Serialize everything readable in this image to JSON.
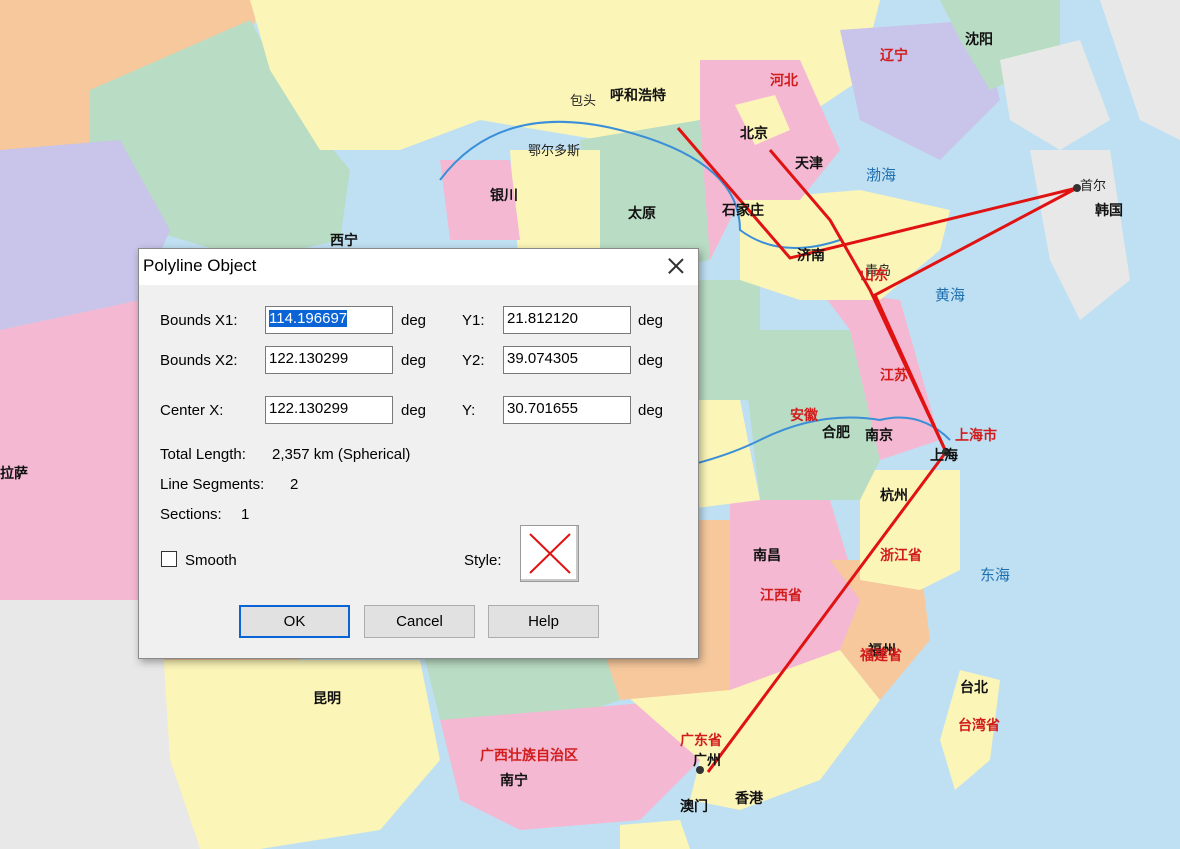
{
  "dialog": {
    "title": "Polyline Object",
    "fields": {
      "bounds_x1_label": "Bounds X1:",
      "bounds_x1_value": "114.196697",
      "bounds_x2_label": "Bounds X2:",
      "bounds_x2_value": "122.130299",
      "center_x_label": "Center X:",
      "center_x_value": "122.130299",
      "y1_label": "Y1:",
      "y1_value": "21.812120",
      "y2_label": "Y2:",
      "y2_value": "39.074305",
      "y_label": "Y:",
      "y_value": "30.701655",
      "unit": "deg"
    },
    "info": {
      "total_length_label": "Total Length:",
      "total_length_value": "2,357 km (Spherical)",
      "line_segments_label": "Line Segments:",
      "line_segments_value": "2",
      "sections_label": "Sections:",
      "sections_value": "1"
    },
    "smooth_label": "Smooth",
    "smooth_checked": false,
    "style_label": "Style:",
    "buttons": {
      "ok": "OK",
      "cancel": "Cancel",
      "help": "Help"
    }
  },
  "map": {
    "labels": [
      {
        "text": "呼和浩特",
        "cls": "big"
      },
      {
        "text": "包头",
        "cls": ""
      },
      {
        "text": "鄂尔多斯",
        "cls": ""
      },
      {
        "text": "银川",
        "cls": "big"
      },
      {
        "text": "太原",
        "cls": "big"
      },
      {
        "text": "石家庄",
        "cls": "big"
      },
      {
        "text": "北京",
        "cls": "big"
      },
      {
        "text": "天津",
        "cls": "big"
      },
      {
        "text": "济南",
        "cls": "big"
      },
      {
        "text": "青岛",
        "cls": ""
      },
      {
        "text": "南京",
        "cls": "big"
      },
      {
        "text": "合肥",
        "cls": "big"
      },
      {
        "text": "上海",
        "cls": "big"
      },
      {
        "text": "杭州",
        "cls": "big"
      },
      {
        "text": "福州",
        "cls": "big"
      },
      {
        "text": "南昌",
        "cls": "big"
      },
      {
        "text": "广州",
        "cls": "big"
      },
      {
        "text": "香港",
        "cls": "big"
      },
      {
        "text": "澳门",
        "cls": "big"
      },
      {
        "text": "南宁",
        "cls": "big"
      },
      {
        "text": "昆明",
        "cls": "big"
      },
      {
        "text": "台北",
        "cls": "big"
      },
      {
        "text": "沈阳",
        "cls": "big"
      },
      {
        "text": "西宁",
        "cls": "big"
      },
      {
        "text": "拉萨",
        "cls": "big"
      },
      {
        "text": "首尔",
        "cls": ""
      },
      {
        "text": "黄海",
        "cls": "sea"
      },
      {
        "text": "东海",
        "cls": "sea"
      },
      {
        "text": "渤海",
        "cls": "sea"
      },
      {
        "text": "河北",
        "cls": "red"
      },
      {
        "text": "山东",
        "cls": "red"
      },
      {
        "text": "江苏",
        "cls": "red"
      },
      {
        "text": "安徽",
        "cls": "red"
      },
      {
        "text": "浙江省",
        "cls": "red"
      },
      {
        "text": "江西省",
        "cls": "red"
      },
      {
        "text": "福建省",
        "cls": "red"
      },
      {
        "text": "广东省",
        "cls": "red"
      },
      {
        "text": "广西壮族自治区",
        "cls": "red"
      },
      {
        "text": "台湾省",
        "cls": "red"
      },
      {
        "text": "辽宁",
        "cls": "red"
      },
      {
        "text": "韩国",
        "cls": "big"
      },
      {
        "text": "上海市",
        "cls": "red"
      }
    ]
  }
}
